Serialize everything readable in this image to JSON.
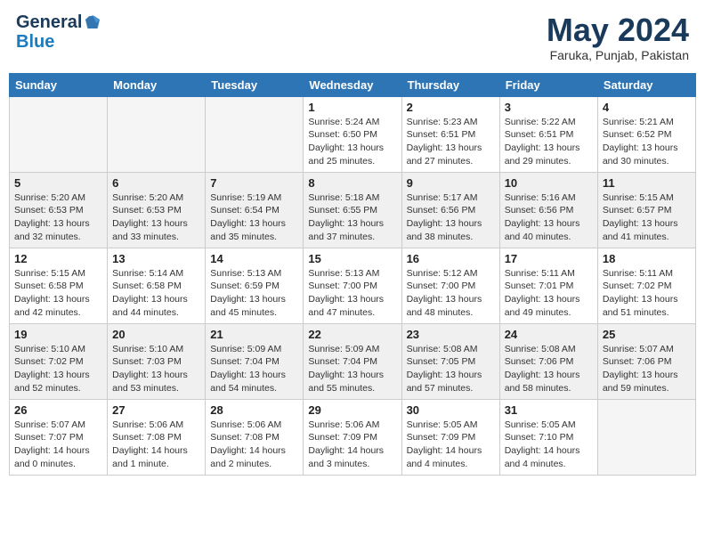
{
  "header": {
    "logo_general": "General",
    "logo_blue": "Blue",
    "month": "May 2024",
    "location": "Faruka, Punjab, Pakistan"
  },
  "weekdays": [
    "Sunday",
    "Monday",
    "Tuesday",
    "Wednesday",
    "Thursday",
    "Friday",
    "Saturday"
  ],
  "weeks": [
    {
      "shaded": false,
      "days": [
        {
          "num": "",
          "info": ""
        },
        {
          "num": "",
          "info": ""
        },
        {
          "num": "",
          "info": ""
        },
        {
          "num": "1",
          "info": "Sunrise: 5:24 AM\nSunset: 6:50 PM\nDaylight: 13 hours\nand 25 minutes."
        },
        {
          "num": "2",
          "info": "Sunrise: 5:23 AM\nSunset: 6:51 PM\nDaylight: 13 hours\nand 27 minutes."
        },
        {
          "num": "3",
          "info": "Sunrise: 5:22 AM\nSunset: 6:51 PM\nDaylight: 13 hours\nand 29 minutes."
        },
        {
          "num": "4",
          "info": "Sunrise: 5:21 AM\nSunset: 6:52 PM\nDaylight: 13 hours\nand 30 minutes."
        }
      ]
    },
    {
      "shaded": true,
      "days": [
        {
          "num": "5",
          "info": "Sunrise: 5:20 AM\nSunset: 6:53 PM\nDaylight: 13 hours\nand 32 minutes."
        },
        {
          "num": "6",
          "info": "Sunrise: 5:20 AM\nSunset: 6:53 PM\nDaylight: 13 hours\nand 33 minutes."
        },
        {
          "num": "7",
          "info": "Sunrise: 5:19 AM\nSunset: 6:54 PM\nDaylight: 13 hours\nand 35 minutes."
        },
        {
          "num": "8",
          "info": "Sunrise: 5:18 AM\nSunset: 6:55 PM\nDaylight: 13 hours\nand 37 minutes."
        },
        {
          "num": "9",
          "info": "Sunrise: 5:17 AM\nSunset: 6:56 PM\nDaylight: 13 hours\nand 38 minutes."
        },
        {
          "num": "10",
          "info": "Sunrise: 5:16 AM\nSunset: 6:56 PM\nDaylight: 13 hours\nand 40 minutes."
        },
        {
          "num": "11",
          "info": "Sunrise: 5:15 AM\nSunset: 6:57 PM\nDaylight: 13 hours\nand 41 minutes."
        }
      ]
    },
    {
      "shaded": false,
      "days": [
        {
          "num": "12",
          "info": "Sunrise: 5:15 AM\nSunset: 6:58 PM\nDaylight: 13 hours\nand 42 minutes."
        },
        {
          "num": "13",
          "info": "Sunrise: 5:14 AM\nSunset: 6:58 PM\nDaylight: 13 hours\nand 44 minutes."
        },
        {
          "num": "14",
          "info": "Sunrise: 5:13 AM\nSunset: 6:59 PM\nDaylight: 13 hours\nand 45 minutes."
        },
        {
          "num": "15",
          "info": "Sunrise: 5:13 AM\nSunset: 7:00 PM\nDaylight: 13 hours\nand 47 minutes."
        },
        {
          "num": "16",
          "info": "Sunrise: 5:12 AM\nSunset: 7:00 PM\nDaylight: 13 hours\nand 48 minutes."
        },
        {
          "num": "17",
          "info": "Sunrise: 5:11 AM\nSunset: 7:01 PM\nDaylight: 13 hours\nand 49 minutes."
        },
        {
          "num": "18",
          "info": "Sunrise: 5:11 AM\nSunset: 7:02 PM\nDaylight: 13 hours\nand 51 minutes."
        }
      ]
    },
    {
      "shaded": true,
      "days": [
        {
          "num": "19",
          "info": "Sunrise: 5:10 AM\nSunset: 7:02 PM\nDaylight: 13 hours\nand 52 minutes."
        },
        {
          "num": "20",
          "info": "Sunrise: 5:10 AM\nSunset: 7:03 PM\nDaylight: 13 hours\nand 53 minutes."
        },
        {
          "num": "21",
          "info": "Sunrise: 5:09 AM\nSunset: 7:04 PM\nDaylight: 13 hours\nand 54 minutes."
        },
        {
          "num": "22",
          "info": "Sunrise: 5:09 AM\nSunset: 7:04 PM\nDaylight: 13 hours\nand 55 minutes."
        },
        {
          "num": "23",
          "info": "Sunrise: 5:08 AM\nSunset: 7:05 PM\nDaylight: 13 hours\nand 57 minutes."
        },
        {
          "num": "24",
          "info": "Sunrise: 5:08 AM\nSunset: 7:06 PM\nDaylight: 13 hours\nand 58 minutes."
        },
        {
          "num": "25",
          "info": "Sunrise: 5:07 AM\nSunset: 7:06 PM\nDaylight: 13 hours\nand 59 minutes."
        }
      ]
    },
    {
      "shaded": false,
      "days": [
        {
          "num": "26",
          "info": "Sunrise: 5:07 AM\nSunset: 7:07 PM\nDaylight: 14 hours\nand 0 minutes."
        },
        {
          "num": "27",
          "info": "Sunrise: 5:06 AM\nSunset: 7:08 PM\nDaylight: 14 hours\nand 1 minute."
        },
        {
          "num": "28",
          "info": "Sunrise: 5:06 AM\nSunset: 7:08 PM\nDaylight: 14 hours\nand 2 minutes."
        },
        {
          "num": "29",
          "info": "Sunrise: 5:06 AM\nSunset: 7:09 PM\nDaylight: 14 hours\nand 3 minutes."
        },
        {
          "num": "30",
          "info": "Sunrise: 5:05 AM\nSunset: 7:09 PM\nDaylight: 14 hours\nand 4 minutes."
        },
        {
          "num": "31",
          "info": "Sunrise: 5:05 AM\nSunset: 7:10 PM\nDaylight: 14 hours\nand 4 minutes."
        },
        {
          "num": "",
          "info": ""
        }
      ]
    }
  ]
}
